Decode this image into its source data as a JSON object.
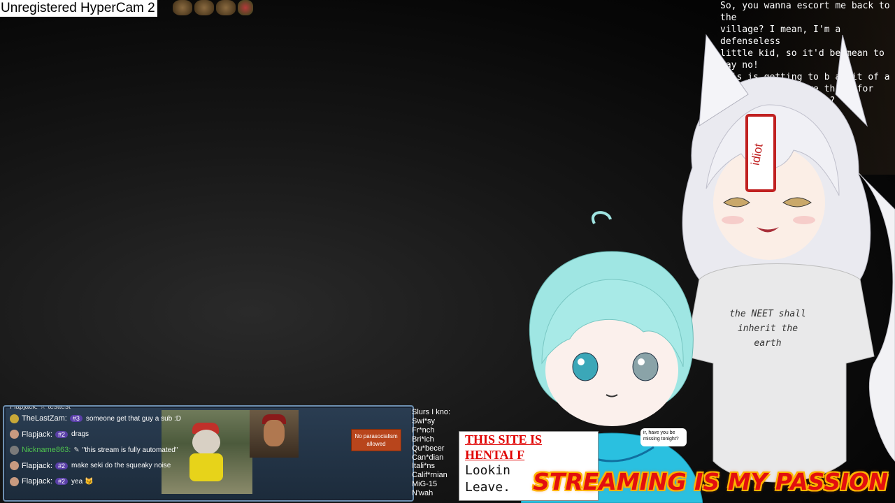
{
  "watermark": {
    "text": "Unregistered HyperCam 2"
  },
  "story": {
    "text": "So, you wanna escort me back to the\nvillage? I mean, I'm a defenseless\nlittle kid, so it'd be mean to say no!\nThis is getting to b a bit of a\nhabit. Do you have thing for\nolder women or s ing?\n into my\n you wish.\n ll-done…\n se medium-\n any of\n ust…"
  },
  "fox_shirt": {
    "line1": "the NEET shall",
    "line2": "inherit the",
    "line3": "earth"
  },
  "fox_tag": "idiot",
  "chat": {
    "top_partial": "Flapjack:  ☆  testtest",
    "messages": [
      {
        "name": "TheLastZam:",
        "badge": "#3",
        "text": "someone get that guy a sub :D",
        "name_color": "#ffffff",
        "avatar_color": "#c8a838"
      },
      {
        "name": "Flapjack:",
        "badge": "#2",
        "text": "drags",
        "name_color": "#ffffff",
        "avatar_color": "#c89a80"
      },
      {
        "name": "Nickname863:",
        "badge": "",
        "text": "\"this stream is fully automated\"",
        "name_color": "#4ec24e",
        "avatar_color": "#7a7a7a"
      },
      {
        "name": "Flapjack:",
        "badge": "#2",
        "text": "make seki do the squeaky noise",
        "name_color": "#ffffff",
        "avatar_color": "#c89a80"
      },
      {
        "name": "Flapjack:",
        "badge": "#2",
        "text": "yea 😼",
        "name_color": "#ffffff",
        "avatar_color": "#c89a80"
      }
    ],
    "sign": "No parasocialism allowed"
  },
  "slurs": {
    "title": "Slurs I kno:",
    "items": [
      "Swi*sy",
      "Fr*nch",
      "Bri*ich",
      "Qu*becer",
      "Can*dian",
      "Itali*ns",
      "Calif*rnian",
      "MiG-15",
      "N'wah"
    ]
  },
  "site": {
    "line1": "THIS SITE IS",
    "line2": "HENTAI F",
    "line3": "Lookin",
    "line4": "Leave."
  },
  "bubble": {
    "text": "ir, have you be missing tonight?"
  },
  "banner": {
    "text": "STREAMING IS MY PASSION"
  },
  "colors": {
    "banner_fill": "#e20f0f",
    "banner_outline": "#ffb400",
    "chat_border": "#6d8fb0",
    "site_red": "#e00000"
  }
}
